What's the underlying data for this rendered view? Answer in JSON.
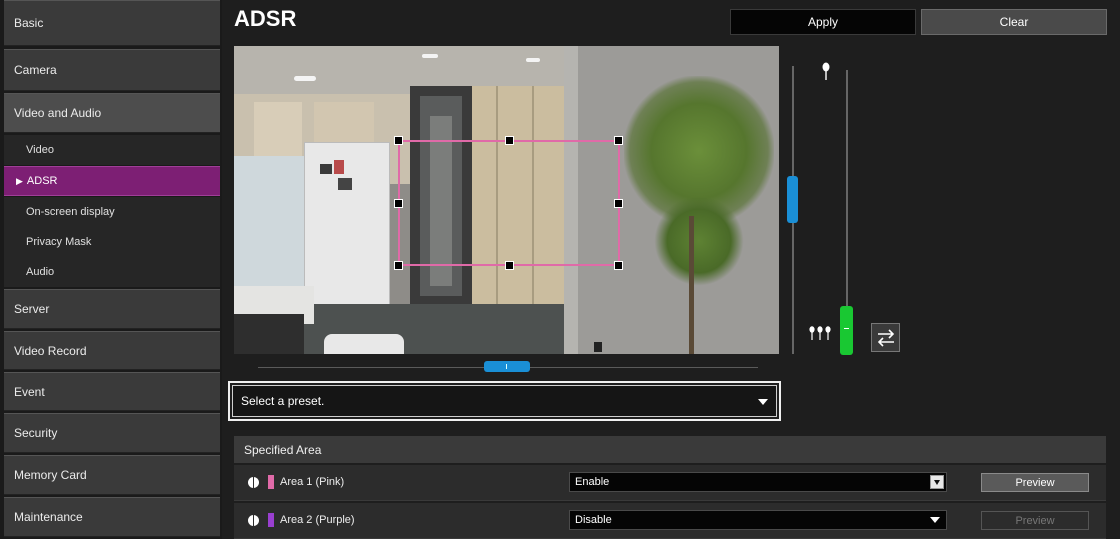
{
  "sidebar": {
    "items": [
      {
        "label": "Basic"
      },
      {
        "label": "Camera"
      },
      {
        "label": "Video and Audio"
      },
      {
        "label": "Server"
      },
      {
        "label": "Video Record"
      },
      {
        "label": "Event"
      },
      {
        "label": "Security"
      },
      {
        "label": "Memory Card"
      },
      {
        "label": "Maintenance"
      }
    ],
    "sub_items": [
      {
        "label": "Video"
      },
      {
        "label": "ADSR"
      },
      {
        "label": "On-screen display"
      },
      {
        "label": "Privacy Mask"
      },
      {
        "label": "Audio"
      }
    ],
    "active_sub": "ADSR"
  },
  "header": {
    "title": "ADSR",
    "apply_label": "Apply",
    "clear_label": "Clear"
  },
  "preset": {
    "value": "Select a preset."
  },
  "specified_area": {
    "heading": "Specified Area",
    "rows": [
      {
        "label": "Area 1 (Pink)",
        "color": "#e06aa8",
        "value": "Enable",
        "preview_label": "Preview",
        "preview_enabled": true
      },
      {
        "label": "Area 2 (Purple)",
        "color": "#9a3fd0",
        "value": "Disable",
        "preview_label": "Preview",
        "preview_enabled": false
      }
    ]
  },
  "colors": {
    "accent_active": "#7d1f74",
    "slider_blue": "#1a8fd6",
    "slider_green": "#19c832"
  },
  "icons": {
    "single_tree": "tree-icon",
    "multi_tree": "trees-icon",
    "swap": "swap-arrows-icon",
    "info": "info-icon"
  }
}
